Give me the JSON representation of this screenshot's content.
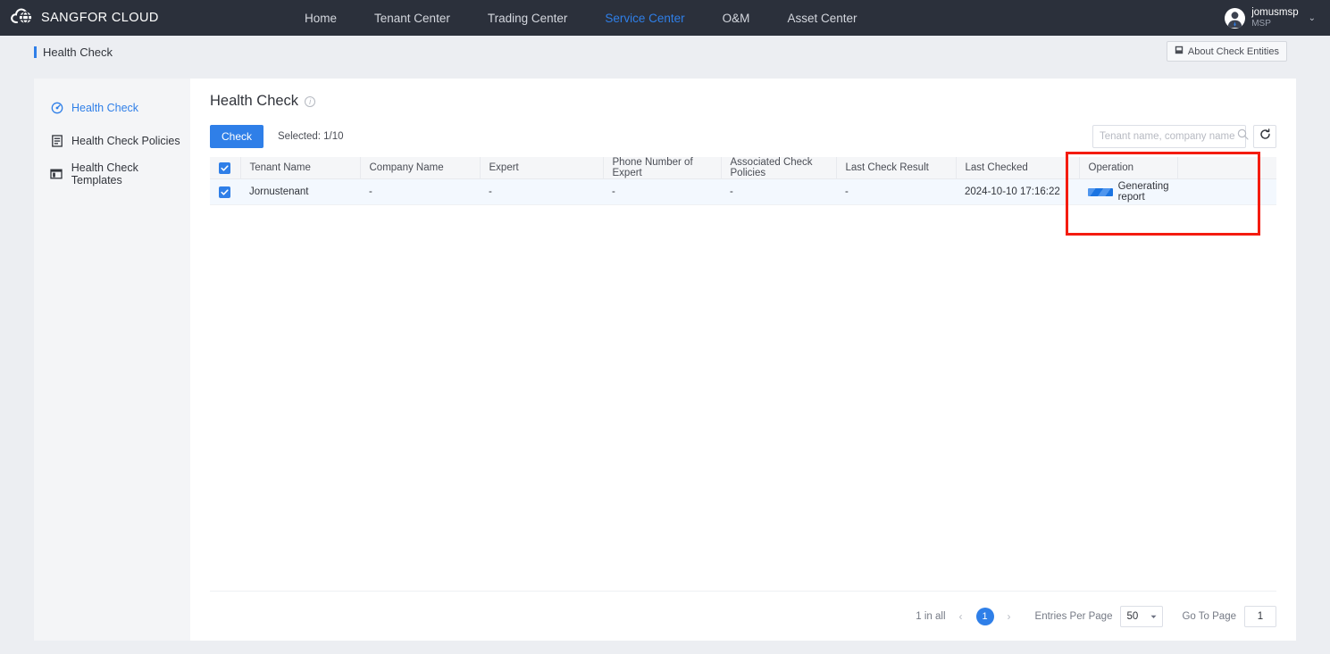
{
  "topbar": {
    "brand": "SANGFOR CLOUD",
    "nav": [
      {
        "label": "Home",
        "active": false
      },
      {
        "label": "Tenant Center",
        "active": false
      },
      {
        "label": "Trading Center",
        "active": false
      },
      {
        "label": "Service Center",
        "active": true
      },
      {
        "label": "O&M",
        "active": false
      },
      {
        "label": "Asset Center",
        "active": false
      }
    ],
    "user": {
      "name": "jomusmsp",
      "role": "MSP"
    },
    "accent": "#2f7fe8",
    "background": "#2b303b"
  },
  "breadcrumb": {
    "title": "Health Check",
    "about_button": "About Check Entities"
  },
  "sidebar": {
    "items": [
      {
        "label": "Health Check",
        "icon": "gauge-icon",
        "active": true
      },
      {
        "label": "Health Check Policies",
        "icon": "document-icon",
        "active": false
      },
      {
        "label": "Health Check Templates",
        "icon": "template-icon",
        "active": false
      }
    ]
  },
  "main": {
    "page_title": "Health Check",
    "toolbar": {
      "check_label": "Check",
      "selected_text": "Selected: 1/10",
      "search_placeholder": "Tenant name, company name",
      "search_value": ""
    },
    "table": {
      "columns": [
        "Tenant Name",
        "Company Name",
        "Expert",
        "Phone Number of Expert",
        "Associated Check Policies",
        "Last Check Result",
        "Last Checked",
        "Operation"
      ],
      "rows": [
        {
          "checked": true,
          "tenant_name": "Jornustenant",
          "company_name": "-",
          "expert": "-",
          "phone_number_of_expert": "-",
          "associated_check_policies": "-",
          "last_check_result": "-",
          "last_checked": "2024-10-10 17:16:22",
          "operation_status": "Generating report"
        }
      ]
    },
    "pagination": {
      "total_text": "1 in all",
      "current_page": "1",
      "entries_label": "Entries Per Page",
      "entries_value": "50",
      "goto_label": "Go To Page",
      "goto_value": "1"
    }
  }
}
